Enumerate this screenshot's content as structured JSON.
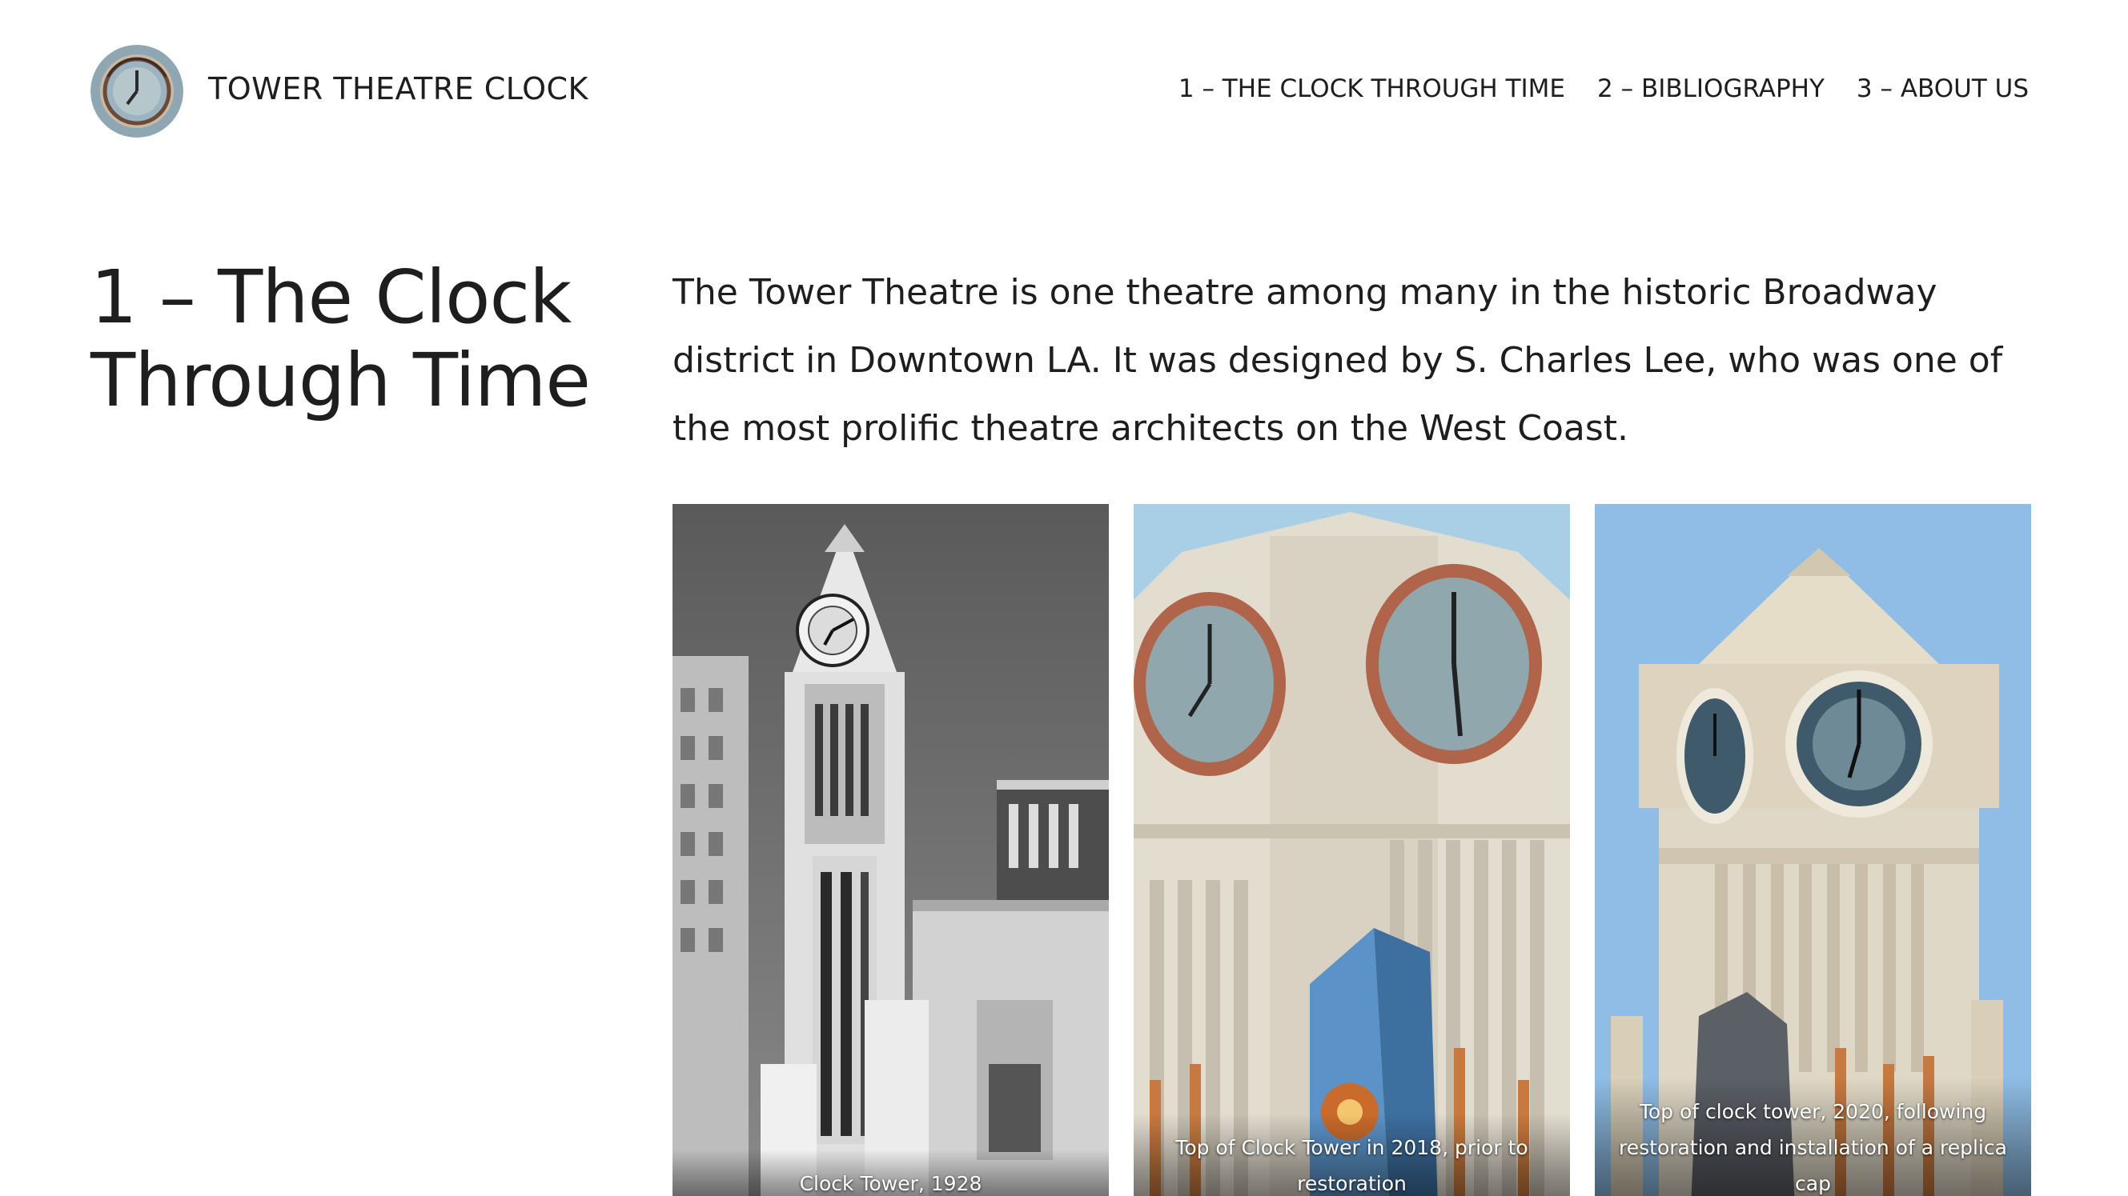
{
  "site": {
    "title": "TOWER THEATRE CLOCK"
  },
  "nav": {
    "items": [
      {
        "label": "1 – THE CLOCK THROUGH TIME"
      },
      {
        "label": "2 – BIBLIOGRAPHY"
      },
      {
        "label": "3 – ABOUT US"
      }
    ]
  },
  "main": {
    "title": "1 – The Clock Through Time",
    "intro": "The Tower Theatre is one theatre among many in the historic Broadway district in Downtown LA. It was designed by S. Charles Lee, who was one of the most prolific theatre architects on the West Coast."
  },
  "gallery": {
    "images": [
      {
        "caption": "Clock Tower, 1928"
      },
      {
        "caption": "Top of Clock Tower in 2018, prior to restoration"
      },
      {
        "caption": "Top of clock tower, 2020, following restoration and installation of a replica cap"
      }
    ]
  },
  "colors": {
    "text": "#1e1e1e",
    "background": "#ffffff",
    "sky_2018": "#a9cfe6",
    "sky_2020": "#8fbde5",
    "stone": "#e3ddd0",
    "clock_rim": "#b0654a"
  }
}
